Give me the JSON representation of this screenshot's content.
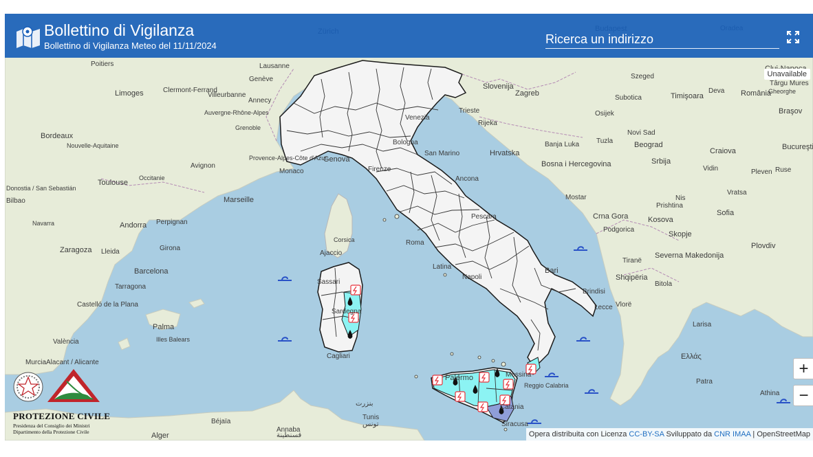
{
  "header": {
    "title": "Bollettino di Vigilanza",
    "subtitle": "Bollettino di Vigilanza Meteo del 11/11/2024",
    "search_placeholder": "Ricerca un indirizzo"
  },
  "map": {
    "unavailable_label": "Unavailable",
    "zoom_in_label": "+",
    "zoom_out_label": "−",
    "attribution": {
      "prefix": "Opera distribuita con Licenza",
      "license_link": "CC-BY-SA",
      "developed_by": "Sviluppato da",
      "developer_link": "CNR IMAA",
      "separator": "|",
      "osm": "OpenStreetMap"
    },
    "colors": {
      "sea": "#a9cde2",
      "land": "#e7ecd9",
      "italy": "#f4f4f4",
      "alert_cyan": "#8cf3f3",
      "alert_blue": "#8f9ed8",
      "header": "#195fb9",
      "wave_icon": "#2952c7",
      "lightning_icon": "#e8323a"
    },
    "place_labels": [
      {
        "text": "Zürich"
      },
      {
        "text": "Budapest"
      },
      {
        "text": "Oradea"
      },
      {
        "text": "Cluj-Napoca"
      },
      {
        "text": "Târgu Mures"
      },
      {
        "text": "Poitiers"
      },
      {
        "text": "Lausanne"
      },
      {
        "text": "Genève"
      },
      {
        "text": "Limoges"
      },
      {
        "text": "Clermont-Ferrand"
      },
      {
        "text": "Villeurbanne"
      },
      {
        "text": "Annecy"
      },
      {
        "text": "Auvergne-Rhône-Alpes"
      },
      {
        "text": "Grenoble"
      },
      {
        "text": "Bordeaux"
      },
      {
        "text": "Nouvelle-Aquitaine"
      },
      {
        "text": "Toulouse"
      },
      {
        "text": "Occitanie"
      },
      {
        "text": "Avignon"
      },
      {
        "text": "Provence-Alpes-Côte d'Azur"
      },
      {
        "text": "Marseille"
      },
      {
        "text": "Monaco"
      },
      {
        "text": "Genova"
      },
      {
        "text": "Venezia"
      },
      {
        "text": "Trieste"
      },
      {
        "text": "Slovenija"
      },
      {
        "text": "Zagreb"
      },
      {
        "text": "Szeged"
      },
      {
        "text": "Timişoara"
      },
      {
        "text": "Deva"
      },
      {
        "text": "România"
      },
      {
        "text": "Gheorghe"
      },
      {
        "text": "Braşov"
      },
      {
        "text": "Rijeka"
      },
      {
        "text": "Hrvatska"
      },
      {
        "text": "Osijek"
      },
      {
        "text": "Novi Sad"
      },
      {
        "text": "Subotica"
      },
      {
        "text": "Craiova"
      },
      {
        "text": "Bucureşti"
      },
      {
        "text": "Banja Luka"
      },
      {
        "text": "Tuzla"
      },
      {
        "text": "Beograd"
      },
      {
        "text": "Srbija"
      },
      {
        "text": "Bosna i Hercegovina"
      },
      {
        "text": "Mostar"
      },
      {
        "text": "Nis"
      },
      {
        "text": "Vidin"
      },
      {
        "text": "Pleven"
      },
      {
        "text": "Ruse"
      },
      {
        "text": "Vratsa"
      },
      {
        "text": "Sofia"
      },
      {
        "text": "Plovdiv"
      },
      {
        "text": "Crna Gora"
      },
      {
        "text": "Podgorica"
      },
      {
        "text": "Kosova"
      },
      {
        "text": "Prishtina"
      },
      {
        "text": "Skopje"
      },
      {
        "text": "Severna Makedonija"
      },
      {
        "text": "Shqipëria"
      },
      {
        "text": "Tiranë"
      },
      {
        "text": "Vlorë"
      },
      {
        "text": "Bitola"
      },
      {
        "text": "Larisa"
      },
      {
        "text": "Ελλάς"
      },
      {
        "text": "Patra"
      },
      {
        "text": "Athina"
      },
      {
        "text": "Bari"
      },
      {
        "text": "Brindisi"
      },
      {
        "text": "Lecce"
      },
      {
        "text": "Napoli"
      },
      {
        "text": "Roma"
      },
      {
        "text": "Latina"
      },
      {
        "text": "Firenze"
      },
      {
        "text": "Bologna"
      },
      {
        "text": "Ancona"
      },
      {
        "text": "Pescara"
      },
      {
        "text": "San Marino"
      },
      {
        "text": "Ajaccio"
      },
      {
        "text": "Corsica"
      },
      {
        "text": "Sardegna"
      },
      {
        "text": "Cagliari"
      },
      {
        "text": "Sassari"
      },
      {
        "text": "Palermo"
      },
      {
        "text": "Messina"
      },
      {
        "text": "Catania"
      },
      {
        "text": "Siracusa"
      },
      {
        "text": "Reggio Calabria"
      },
      {
        "text": "Andorra"
      },
      {
        "text": "Perpignan"
      },
      {
        "text": "Girona"
      },
      {
        "text": "Lleida"
      },
      {
        "text": "Zaragoza"
      },
      {
        "text": "Barcelona"
      },
      {
        "text": "Navarra"
      },
      {
        "text": "Donostia / San Sebastián"
      },
      {
        "text": "Bilbao"
      },
      {
        "text": "Tarragona"
      },
      {
        "text": "Castelló de la Plana"
      },
      {
        "text": "València"
      },
      {
        "text": "Palma"
      },
      {
        "text": "Illes Balears"
      },
      {
        "text": "Alacant / Alicante"
      },
      {
        "text": "Murcia"
      },
      {
        "text": "Alger"
      },
      {
        "text": "Béjaïa"
      },
      {
        "text": "Annaba"
      },
      {
        "text": "Tunis"
      },
      {
        "text": "تونس"
      },
      {
        "text": "قسنطينة"
      },
      {
        "text": "بنزرت"
      }
    ],
    "wave_icons": [
      {
        "name": "wave-icon-ligure"
      },
      {
        "name": "wave-icon-tirreno"
      },
      {
        "name": "wave-icon-sardegna-sud"
      },
      {
        "name": "wave-icon-adriatico"
      },
      {
        "name": "wave-icon-ionio-nord"
      },
      {
        "name": "wave-icon-ionio-calabria"
      },
      {
        "name": "wave-icon-ionio-sud"
      },
      {
        "name": "wave-icon-sicilia-sud"
      }
    ]
  },
  "branding": {
    "org_title": "PROTEZIONE CIVILE",
    "org_line1": "Presidenza del Consiglio dei Ministri",
    "org_line2": "Dipartimento della Protezione Civile"
  }
}
